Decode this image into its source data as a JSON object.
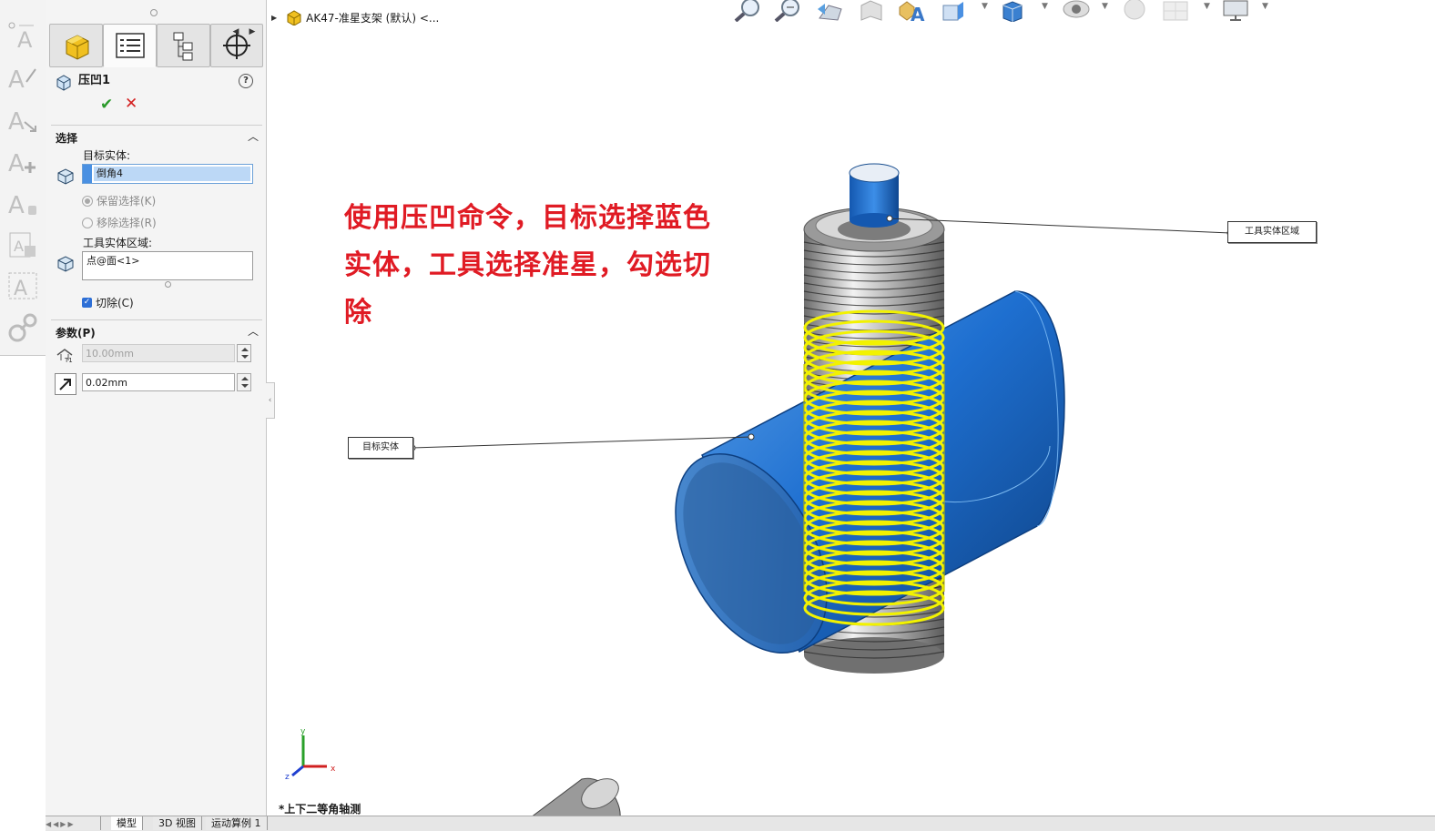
{
  "document": {
    "tree_title": "AK47-准星支架 (默认) <..."
  },
  "left_strip": {
    "tools": [
      {
        "name": "smart-dimension-icon"
      },
      {
        "name": "text-auto-icon"
      },
      {
        "name": "text-arrow-icon"
      },
      {
        "name": "text-plus-icon"
      },
      {
        "name": "text-lock-icon"
      },
      {
        "name": "text-stamp-icon"
      },
      {
        "name": "text-frame-icon"
      },
      {
        "name": "gear-link-icon"
      }
    ]
  },
  "panel": {
    "tabs": [
      {
        "name": "feature-manager-tab",
        "icon": "part-cube-icon"
      },
      {
        "name": "property-manager-tab",
        "icon": "property-list-icon"
      },
      {
        "name": "configuration-manager-tab",
        "icon": "configuration-icon"
      },
      {
        "name": "dimxpert-tab",
        "icon": "crosshair-icon"
      }
    ],
    "feature_title": "压凹1",
    "sections": {
      "selection": {
        "title": "选择",
        "target_label": "目标实体:",
        "target_value": "倒角4",
        "keep_selection": "保留选择(K)",
        "remove_selection": "移除选择(R)",
        "tool_region_label": "工具实体区域:",
        "tool_region_value": "点@面<1>",
        "cut_label": "切除(C)",
        "cut_checked": true
      },
      "parameters": {
        "title": "参数(P)",
        "thickness_value": "10.00mm",
        "clearance_value": "0.02mm"
      }
    }
  },
  "viewport": {
    "annotation_lines": [
      "使用压凹命令，目标选择蓝色",
      "实体，工具选择准星，勾选切",
      "除"
    ],
    "callouts": {
      "tool_region": "工具实体区域",
      "target_body": "目标实体"
    },
    "triad": {
      "x": "x",
      "y": "y",
      "z": "z"
    },
    "view_name": "*上下二等角轴测"
  },
  "bottom_tabs": [
    {
      "label": "模型",
      "active": true
    },
    {
      "label": "3D 视图",
      "active": false
    },
    {
      "label": "运动算例 1",
      "active": false
    }
  ],
  "colors": {
    "annotation": "#e01b24",
    "target_body": "#1e6fd0",
    "tool_body": "#f2f200",
    "ok": "#2a9a2a",
    "cancel": "#d42020"
  }
}
